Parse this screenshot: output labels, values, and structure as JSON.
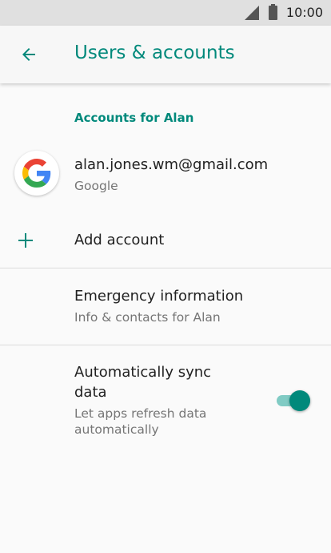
{
  "status_bar": {
    "time": "10:00"
  },
  "app_bar": {
    "title": "Users & accounts",
    "accent": "#00897b"
  },
  "accounts_section": {
    "header": "Accounts for Alan",
    "account": {
      "email": "alan.jones.wm@gmail.com",
      "provider": "Google",
      "icon": "google-icon"
    },
    "add_account_label": "Add account"
  },
  "emergency": {
    "title": "Emergency information",
    "subtitle": "Info & contacts for Alan"
  },
  "sync": {
    "title_line1": "Automatically sync",
    "title_line2": "data",
    "subtitle_line1": "Let apps refresh data",
    "subtitle_line2": "automatically",
    "enabled": true
  }
}
